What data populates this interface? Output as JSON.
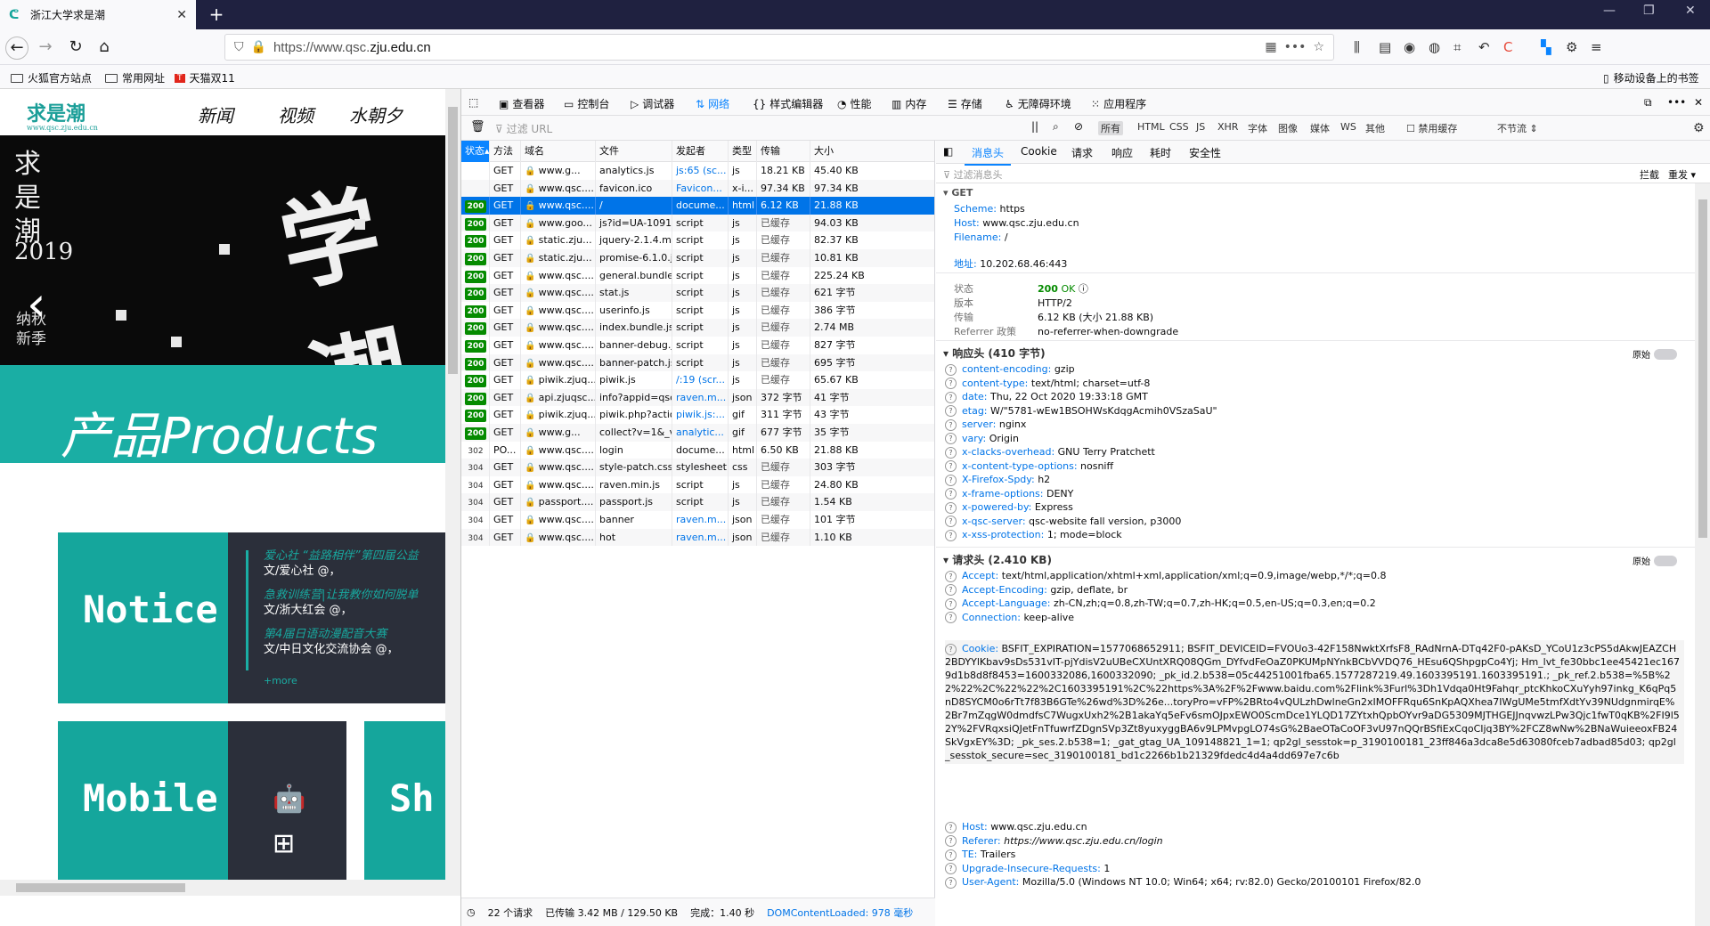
{
  "browser": {
    "tab_title": "浙江大学求是潮",
    "url_prefix": "https://www.qsc.",
    "url_domain": "zju.edu.cn",
    "bookmarks": [
      "火狐官方站点",
      "常用网址",
      "天猫双11"
    ],
    "mobile_bookmarks": "移动设备上的书签"
  },
  "site": {
    "logo": "求是潮",
    "logo_sub": "www.qsc.zju.edu.cn",
    "nav": [
      "新闻",
      "视频",
      "水朝夕"
    ],
    "banner_vertical": "求是潮",
    "banner_year": "2019",
    "banner_sub": "纳秋新季",
    "products": "产品Products",
    "notice_word": "Notice",
    "mobile_word": "Mobile",
    "notices": [
      {
        "title": "爱心社 “益路相伴”第四届公益",
        "author": "文/爱心社 @，"
      },
      {
        "title": "急救训练营|让我教你如何脱单",
        "author": "文/浙大红会 @，"
      },
      {
        "title": "第4届日语动漫配音大赛",
        "author": "文/中日文化交流协会 @，"
      }
    ],
    "more": "+more"
  },
  "devtools": {
    "tabs": [
      "查看器",
      "控制台",
      "调试器",
      "网络",
      "样式编辑器",
      "性能",
      "内存",
      "存储",
      "无障碍环境",
      "应用程序"
    ],
    "filter_placeholder": "过滤 URL",
    "type_filters": [
      "所有",
      "HTML",
      "CSS",
      "JS",
      "XHR",
      "字体",
      "图像",
      "媒体",
      "WS",
      "其他"
    ],
    "disable_cache": "禁用缓存",
    "throttle": "不节流",
    "columns": [
      "状态",
      "方法",
      "域名",
      "文件",
      "发起者",
      "类型",
      "传输",
      "大小"
    ],
    "requests": [
      {
        "status": "",
        "method": "GET",
        "domain": "www.g...",
        "file": "analytics.js",
        "initiator": "js:65 (sc...",
        "type": "js",
        "transfer": "18.21 KB",
        "size": "45.40 KB"
      },
      {
        "status": "",
        "method": "GET",
        "domain": "www.qsc....",
        "file": "favicon.ico",
        "initiator": "Favicon...",
        "type": "x-i...",
        "transfer": "97.34 KB",
        "size": "97.34 KB"
      },
      {
        "status": "200",
        "method": "GET",
        "domain": "www.qsc....",
        "file": "/",
        "initiator": "docume...",
        "type": "html",
        "transfer": "6.12 KB",
        "size": "21.88 KB"
      },
      {
        "status": "200",
        "method": "GET",
        "domain": "www.goo...",
        "file": "js?id=UA-1091...",
        "initiator": "script",
        "type": "js",
        "transfer": "已缓存",
        "size": "94.03 KB"
      },
      {
        "status": "200",
        "method": "GET",
        "domain": "static.zju...",
        "file": "jquery-2.1.4.mi...",
        "initiator": "script",
        "type": "js",
        "transfer": "已缓存",
        "size": "82.37 KB"
      },
      {
        "status": "200",
        "method": "GET",
        "domain": "static.zju...",
        "file": "promise-6.1.0.js",
        "initiator": "script",
        "type": "js",
        "transfer": "已缓存",
        "size": "10.81 KB"
      },
      {
        "status": "200",
        "method": "GET",
        "domain": "www.qsc....",
        "file": "general.bundle....",
        "initiator": "script",
        "type": "js",
        "transfer": "已缓存",
        "size": "225.24 KB"
      },
      {
        "status": "200",
        "method": "GET",
        "domain": "www.qsc....",
        "file": "stat.js",
        "initiator": "script",
        "type": "js",
        "transfer": "已缓存",
        "size": "621 字节"
      },
      {
        "status": "200",
        "method": "GET",
        "domain": "www.qsc....",
        "file": "userinfo.js",
        "initiator": "script",
        "type": "js",
        "transfer": "已缓存",
        "size": "386 字节"
      },
      {
        "status": "200",
        "method": "GET",
        "domain": "www.qsc....",
        "file": "index.bundle.js",
        "initiator": "script",
        "type": "js",
        "transfer": "已缓存",
        "size": "2.74 MB"
      },
      {
        "status": "200",
        "method": "GET",
        "domain": "www.qsc....",
        "file": "banner-debug.j...",
        "initiator": "script",
        "type": "js",
        "transfer": "已缓存",
        "size": "827 字节"
      },
      {
        "status": "200",
        "method": "GET",
        "domain": "www.qsc....",
        "file": "banner-patch.js",
        "initiator": "script",
        "type": "js",
        "transfer": "已缓存",
        "size": "695 字节"
      },
      {
        "status": "200",
        "method": "GET",
        "domain": "piwik.zjuq...",
        "file": "piwik.js",
        "initiator": "/:19 (scr...",
        "type": "js",
        "transfer": "已缓存",
        "size": "65.67 KB"
      },
      {
        "status": "200",
        "method": "GET",
        "domain": "api.zjuqsc...",
        "file": "info?appid=qsc...",
        "initiator": "raven.m...",
        "type": "json",
        "transfer": "372 字节",
        "size": "41 字节"
      },
      {
        "status": "200",
        "method": "GET",
        "domain": "piwik.zjuq...",
        "file": "piwik.php?actio...",
        "initiator": "piwik.js:...",
        "type": "gif",
        "transfer": "311 字节",
        "size": "43 字节"
      },
      {
        "status": "200",
        "method": "GET",
        "domain": "www.g...",
        "file": "collect?v=1&_v...",
        "initiator": "analytic...",
        "type": "gif",
        "transfer": "677 字节",
        "size": "35 字节"
      },
      {
        "status": "302",
        "method": "PO...",
        "domain": "www.qsc....",
        "file": "login",
        "initiator": "docume...",
        "type": "html",
        "transfer": "6.50 KB",
        "size": "21.88 KB"
      },
      {
        "status": "304",
        "method": "GET",
        "domain": "www.qsc....",
        "file": "style-patch.css",
        "initiator": "stylesheet",
        "type": "css",
        "transfer": "已缓存",
        "size": "303 字节"
      },
      {
        "status": "304",
        "method": "GET",
        "domain": "www.qsc....",
        "file": "raven.min.js",
        "initiator": "script",
        "type": "js",
        "transfer": "已缓存",
        "size": "24.80 KB"
      },
      {
        "status": "304",
        "method": "GET",
        "domain": "passport....",
        "file": "passport.js",
        "initiator": "script",
        "type": "js",
        "transfer": "已缓存",
        "size": "1.54 KB"
      },
      {
        "status": "304",
        "method": "GET",
        "domain": "www.qsc....",
        "file": "banner",
        "initiator": "raven.m...",
        "type": "json",
        "transfer": "已缓存",
        "size": "101 字节"
      },
      {
        "status": "304",
        "method": "GET",
        "domain": "www.qsc....",
        "file": "hot",
        "initiator": "raven.m...",
        "type": "json",
        "transfer": "已缓存",
        "size": "1.10 KB"
      }
    ],
    "summary": {
      "requests": "22 个请求",
      "transferred": "已传输 3.42 MB / 129.50 KB",
      "finish": "完成：1.40 秒",
      "dcl": "DOMContentLoaded: 978 毫秒"
    },
    "detail_tabs": [
      "消息头",
      "Cookie",
      "请求",
      "响应",
      "耗时",
      "安全性"
    ],
    "detail_filter": "过滤消息头",
    "detail_actions": [
      "拦截",
      "重发"
    ],
    "general": {
      "method": "GET",
      "scheme_k": "Scheme:",
      "scheme_v": "https",
      "host_k": "Host:",
      "host_v": "www.qsc.zju.edu.cn",
      "filename_k": "Filename:",
      "filename_v": "/",
      "address_k": "地址:",
      "address_v": "10.202.68.46:443",
      "status_k": "状态",
      "status_code": "200",
      "status_text": "OK",
      "version_k": "版本",
      "version_v": "HTTP/2",
      "transfer_k": "传输",
      "transfer_v": "6.12 KB (大小 21.88 KB)",
      "referrer_k": "Referrer 政策",
      "referrer_v": "no-referrer-when-downgrade"
    },
    "response_headers_title": "响应头 (410 字节)",
    "request_headers_title": "请求头 (2.410 KB)",
    "raw_label": "原始",
    "response_headers": [
      {
        "k": "content-encoding:",
        "v": "gzip"
      },
      {
        "k": "content-type:",
        "v": "text/html; charset=utf-8"
      },
      {
        "k": "date:",
        "v": "Thu, 22 Oct 2020 19:33:18 GMT"
      },
      {
        "k": "etag:",
        "v": "W/\"5781-wEw1BSOHWsKdqgAcmih0VSzaSaU\""
      },
      {
        "k": "server:",
        "v": "nginx"
      },
      {
        "k": "vary:",
        "v": "Origin"
      },
      {
        "k": "x-clacks-overhead:",
        "v": "GNU Terry Pratchett"
      },
      {
        "k": "x-content-type-options:",
        "v": "nosniff"
      },
      {
        "k": "X-Firefox-Spdy:",
        "v": "h2"
      },
      {
        "k": "x-frame-options:",
        "v": "DENY"
      },
      {
        "k": "x-powered-by:",
        "v": "Express"
      },
      {
        "k": "x-qsc-server:",
        "v": "qsc-website fall version, p3000"
      },
      {
        "k": "x-xss-protection:",
        "v": "1; mode=block"
      }
    ],
    "request_headers_top": [
      {
        "k": "Accept:",
        "v": "text/html,application/xhtml+xml,application/xml;q=0.9,image/webp,*/*;q=0.8"
      },
      {
        "k": "Accept-Encoding:",
        "v": "gzip, deflate, br"
      },
      {
        "k": "Accept-Language:",
        "v": "zh-CN,zh;q=0.8,zh-TW;q=0.7,zh-HK;q=0.5,en-US;q=0.3,en;q=0.2"
      },
      {
        "k": "Connection:",
        "v": "keep-alive"
      }
    ],
    "cookie_k": "Cookie:",
    "cookie_v": "BSFIT_EXPIRATION=1577068652911; BSFIT_DEVICEID=FVOUo3-42F158NwktXrfsF8_RAdNrnA-DTq42F0-pAKsD_YCoU1z3cPS5dAkwJEAZCH2BDYYlKbav9sDs531vIT-pjYdisV2uUBeCXUntXRQ08QGm_DYfvdFeOaZ0PKUMpNYnkBCbVVDQ76_HEsu6QShpgpCo4Yj; Hm_lvt_fe30bbc1ee45421ec1679d1b8d8f8453=1600332086,1600332090; _pk_id.2.b538=05c44251001fba65.1577287219.49.1603395191.1603395191.; _pk_ref.2.b538=%5B%22%22%2C%22%22%2C1603395191%2C%22https%3A%2F%2Fwww.baidu.com%2Flink%3Furl%3Dh1Vdqa0Ht9Fahqr_ptcKhkoCXuYyh97inkg_K6qPq5nD8SYCM0o6rTt7f83B6GTe%26wd%3D%26e...toryPro=vFP%2BRto4vQULzhDwlneGn2xIMOFFRqu6SnKpAQXhea7IWgUMe5tmfXdtYv39NUdgnmirqE%2Br7mZqgW0dmdfsC7WugxUxh2%2B1akaYq5eFv6smOJpxEWO0ScmDce1YLQD17ZYtxhQpbOYvr9aDG5309MJTHGEJJnqvwzLPw3Qjc1fwT0qKB%2FI9l52Y%2FVRqxsiQJetFnTfuwrfZDgnSVp3Zt8yuxyggBA6v9LPMvpgLO74sG%2BaeOTaCoOF3vU97nQQrBSfiExCqoCIjq3BY%2FCZ8wNw%2BNaWuieeoxFB24SkVgxEY%3D; _pk_ses.2.b538=1; _gat_gtag_UA_109148821_1=1; qp2gl_sesstok=p_3190100181_23ff846a3dca8e5d63080fceb7adbad85d03; qp2gl_sesstok_secure=sec_3190100181_bd1c2266b1b21329fdedc4d4a4dd697e7c6b",
    "request_headers_bottom": [
      {
        "k": "Host:",
        "v": "www.qsc.zju.edu.cn"
      },
      {
        "k": "Referer:",
        "v": "https://www.qsc.zju.edu.cn/login"
      },
      {
        "k": "TE:",
        "v": "Trailers"
      },
      {
        "k": "Upgrade-Insecure-Requests:",
        "v": "1"
      },
      {
        "k": "User-Agent:",
        "v": "Mozilla/5.0 (Windows NT 10.0; Win64; x64; rv:82.0) Gecko/20100101 Firefox/82.0"
      }
    ]
  }
}
